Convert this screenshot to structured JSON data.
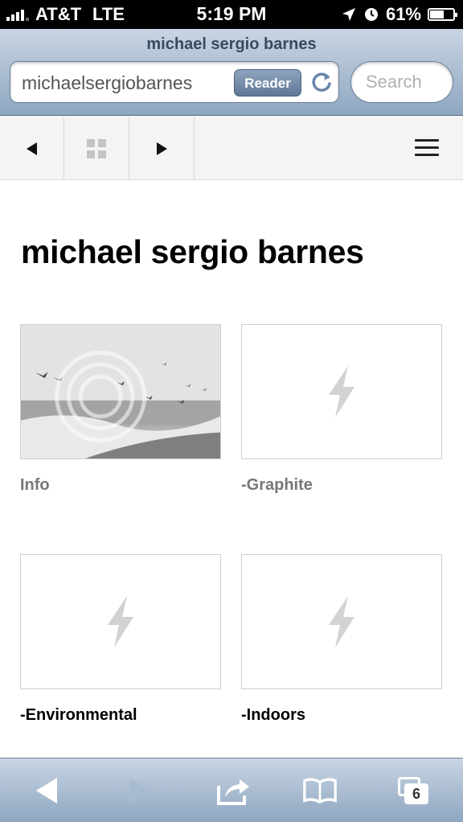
{
  "status_bar": {
    "carrier": "AT&T",
    "network": "LTE",
    "time": "5:19 PM",
    "battery_percent": "61%",
    "battery_level": 0.61
  },
  "browser": {
    "page_title": "michael sergio barnes",
    "url": "michaelsergiobarnes",
    "reader_label": "Reader",
    "search_placeholder": "Search",
    "open_tabs": "6"
  },
  "site_nav": {
    "prev_icon": "left-triangle",
    "grid_icon": "grid-icon",
    "next_icon": "right-triangle",
    "menu_icon": "hamburger-icon"
  },
  "site": {
    "heading": "michael sergio barnes",
    "gallery": [
      {
        "caption": "Info",
        "image": "photo"
      },
      {
        "caption": "-Graphite",
        "image": "placeholder-lightning"
      },
      {
        "caption": "-Environmental",
        "image": "placeholder-lightning"
      },
      {
        "caption": "-Indoors",
        "image": "placeholder-lightning"
      }
    ]
  },
  "colors": {
    "toolbar_top": "#c9d5e3",
    "toolbar_bottom": "#8ea6c1",
    "placeholder_icon": "#d2d2d2"
  }
}
